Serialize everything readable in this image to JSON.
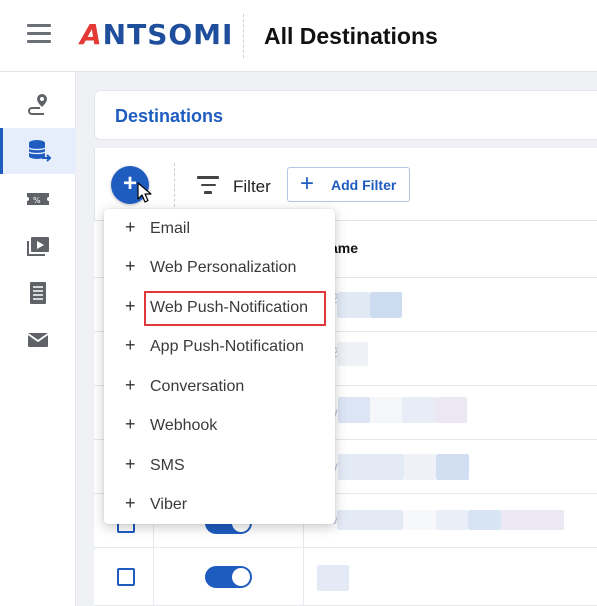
{
  "header": {
    "menu_icon": "hamburger-icon",
    "logo_prefix": "A",
    "logo_rest": "NTSOMI",
    "title": "All Destinations"
  },
  "sidebar": {
    "items": [
      {
        "icon": "journey-pin-icon",
        "active": false
      },
      {
        "icon": "database-export-icon",
        "active": true
      },
      {
        "icon": "promotion-ticket-icon",
        "active": false
      },
      {
        "icon": "media-library-icon",
        "active": false
      },
      {
        "icon": "document-list-icon",
        "active": false
      },
      {
        "icon": "mail-icon",
        "active": false
      }
    ]
  },
  "panel": {
    "title": "Destinations"
  },
  "toolbar": {
    "create_label": "+",
    "filter_label": "Filter",
    "add_filter_plus": "+",
    "add_filter_label": "Add Filter"
  },
  "table": {
    "name_header": "ame",
    "row_prefixes": [
      "2",
      "2",
      "v",
      "v",
      "v",
      ""
    ]
  },
  "menu": {
    "plus": "+",
    "items": [
      "Email",
      "Web Personalization",
      "Web Push-Notification",
      "App Push-Notification",
      "Conversation",
      "Webhook",
      "SMS",
      "Viber"
    ],
    "highlighted_index": 2
  },
  "colors": {
    "brand_blue": "#1f5cc0",
    "logo_red": "#e53935",
    "highlight_red": "#e0383c"
  }
}
